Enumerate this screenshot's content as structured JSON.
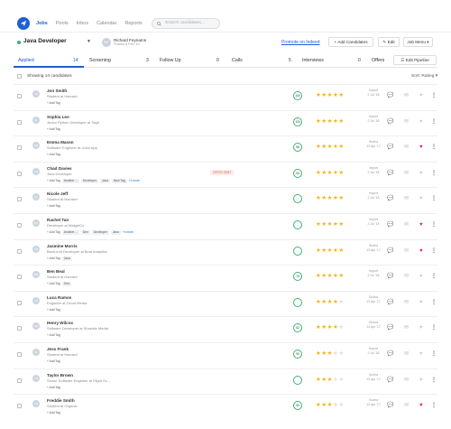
{
  "nav": {
    "links": [
      "Jobs",
      "Pools",
      "Inbox",
      "Calendar",
      "Reports"
    ],
    "active": 0,
    "search_placeholder": "Search candidates..."
  },
  "job": {
    "title": "Java Developer",
    "status_color": "#3cb371"
  },
  "owner": {
    "initials": "RF",
    "name": "Richard Feynamn",
    "subtitle": "Posted 8 Feb '19"
  },
  "actions": {
    "promote": "Promote on Indeed",
    "add": "+ Add Candidates",
    "edit": "Edit",
    "menu": "Job Menu"
  },
  "tabs": [
    {
      "label": "Applied",
      "count": "14"
    },
    {
      "label": "Screening",
      "count": "3"
    },
    {
      "label": "Follow Up",
      "count": "0"
    },
    {
      "label": "Calls",
      "count": "5"
    },
    {
      "label": "Interviews",
      "count": "0"
    },
    {
      "label": "Offers",
      "count": ""
    }
  ],
  "edit_pipeline": "Edit Pipeline",
  "summary": {
    "showing": "Showing 14 candidates",
    "sort": "Sort: Rating"
  },
  "colors": {
    "accent": "#1e5fd6",
    "star": "#f5b51b",
    "heart": "#e0245e"
  },
  "candidates": [
    {
      "initials": "JS",
      "name": "Jon Smith",
      "title": "Student at Harvard",
      "tags": [
        "+ Add Tag"
      ],
      "score": "100",
      "stars": 5,
      "source": "Import",
      "date": "2 Jul '18",
      "heart": false
    },
    {
      "initials": "SL",
      "name": "Sophia Leo",
      "title": "Junior Python Developer at Tagit",
      "tags": [
        "+ Add Tag"
      ],
      "score": "100",
      "stars": 5,
      "source": "Import",
      "date": "2 Jul '18",
      "heart": false
    },
    {
      "initials": "EM",
      "name": "Emma Mason",
      "title": "Software Engineer at Juice App",
      "tags": [
        "+ Add Tag"
      ],
      "score": "98",
      "stars": 5,
      "source": "Sudira",
      "date": "13 Apr '17",
      "heart": true
    },
    {
      "initials": "CD",
      "name": "Chad Davies",
      "title": "Java Developer",
      "tags": [
        "+ Add Tag",
        "Another ...",
        "Developer",
        "Java",
        "New Tag",
        "+2 more"
      ],
      "badge": "OFFER SENT",
      "score": "94",
      "stars": 5,
      "source": "Import",
      "date": "2 Jul '18",
      "heart": false
    },
    {
      "initials": "NJ",
      "name": "Nicole Jeff",
      "title": "Student at Harvard",
      "tags": [
        "+ Add Tag"
      ],
      "score": "-",
      "stars": 4.5,
      "source": "Import",
      "date": "2 Jul '18",
      "heart": false
    },
    {
      "initials": "RT",
      "name": "Rachel Tan",
      "title": "Developer at WidgetCo",
      "tags": [
        "+ Add Tag",
        "Another ...",
        "Dev",
        "Developer",
        "Java",
        "+4 more"
      ],
      "score": "-",
      "stars": 4.5,
      "source": "Import",
      "date": "2 Jul '18",
      "heart": true
    },
    {
      "initials": "JM",
      "name": "Jasmine Morris",
      "title": "Back-end Developer at Beat Analytics",
      "tags": [
        "+ Add Tag",
        "Java"
      ],
      "score": "-",
      "stars": 4.5,
      "source": "Sudira",
      "date": "13 Apr '17",
      "heart": true
    },
    {
      "initials": "BB",
      "name": "Ben Beal",
      "title": "Student at Harvard",
      "tags": [
        "+ Add Tag",
        "Test"
      ],
      "score": "75",
      "stars": 4.5,
      "source": "Import",
      "date": "2 Jul '18",
      "heart": false
    },
    {
      "initials": "LR",
      "name": "Luca Ramos",
      "title": "Engineer at Cloud Media",
      "tags": [
        "+ Add Tag"
      ],
      "score": "-",
      "stars": 4,
      "source": "Sudira",
      "date": "13 Apr '17",
      "heart": false
    },
    {
      "initials": "HW",
      "name": "Henry Wilcox",
      "title": "Software Developer at Showbiz Media",
      "tags": [
        "+ Add Tag"
      ],
      "score": "62",
      "stars": 3.5,
      "source": "Sudira",
      "date": "13 Apr '17",
      "heart": false
    },
    {
      "initials": "JF",
      "name": "Jess Frank",
      "title": "Student at Harvard",
      "tags": [
        "+ Add Tag"
      ],
      "score": "90",
      "stars": 3,
      "source": "Import",
      "date": "2 Jul '18",
      "heart": false
    },
    {
      "initials": "TB",
      "name": "Taylor Brown",
      "title": "Senior Software Engineer at Flight Sc...",
      "tags": [
        "+ Add Tag"
      ],
      "score": "-",
      "stars": 3,
      "source": "Sudira",
      "date": "13 Apr '17",
      "heart": false
    },
    {
      "initials": "FS",
      "name": "Freddie Smith",
      "title": "Student at Orgenie",
      "tags": [
        "+ Add Tag"
      ],
      "score": "90",
      "stars": 3,
      "source": "Sudira",
      "date": "13 Apr '17",
      "heart": true
    }
  ]
}
